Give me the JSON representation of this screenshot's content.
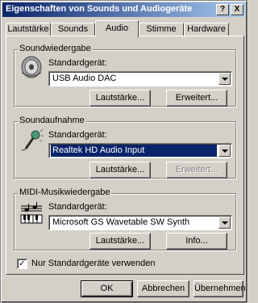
{
  "window": {
    "title": "Eigenschaften von Sounds und Audiogeräte",
    "help_btn": "?",
    "close_btn": "X"
  },
  "tabs": [
    {
      "label": "Lautstärke",
      "active": false
    },
    {
      "label": "Sounds",
      "active": false
    },
    {
      "label": "Audio",
      "active": true
    },
    {
      "label": "Stimme",
      "active": false
    },
    {
      "label": "Hardware",
      "active": false
    }
  ],
  "playback": {
    "group_label": "Soundwiedergabe",
    "icon": "speaker-icon",
    "default_label": "Standardgerät:",
    "device": "USB Audio DAC",
    "volume_btn": "Lautstärke...",
    "advanced_btn": "Erweitert..."
  },
  "recording": {
    "group_label": "Soundaufnahme",
    "icon": "microphone-icon",
    "default_label": "Standardgerät:",
    "device": "Realtek HD Audio Input",
    "volume_btn": "Lautstärke...",
    "advanced_btn": "Erweitert..."
  },
  "midi": {
    "group_label": "MIDI-Musikwiedergabe",
    "icon": "midi-keyboard-icon",
    "default_label": "Standardgerät:",
    "device": "Microsoft GS Wavetable SW Synth",
    "volume_btn": "Lautstärke...",
    "info_btn": "Info..."
  },
  "only_default": {
    "label": "Nur Standardgeräte verwenden",
    "checked": true,
    "mark": "✓"
  },
  "footer": {
    "ok": "OK",
    "cancel": "Abbrechen",
    "apply": "Übernehmen"
  },
  "colors": {
    "titlebar_start": "#0a246a",
    "titlebar_end": "#a6caf0",
    "face": "#d4d0c8",
    "selection": "#0a246a"
  }
}
